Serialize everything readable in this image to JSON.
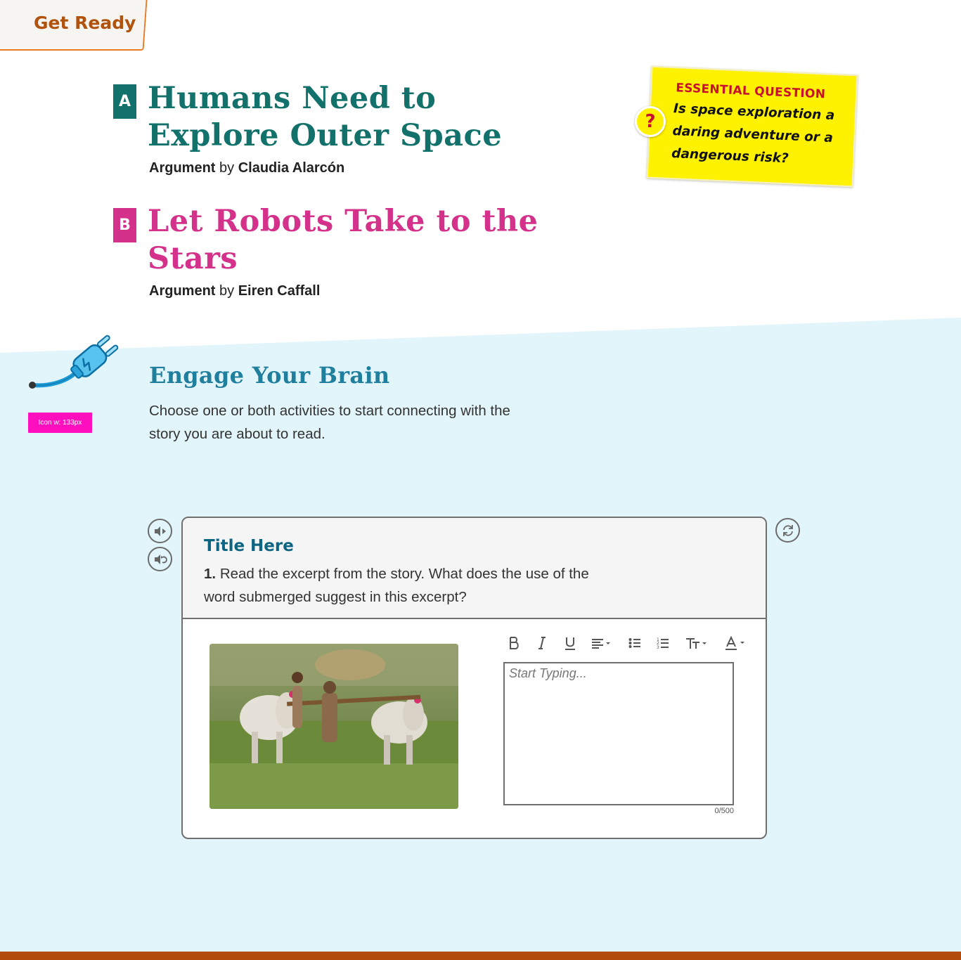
{
  "section_tab": {
    "label": "Get Ready"
  },
  "selections": [
    {
      "badge": "A",
      "title": "Humans Need to Explore Outer Space",
      "genre": "Argument",
      "by": "by",
      "author": "Claudia Alarcón",
      "color": "#12726b"
    },
    {
      "badge": "B",
      "title": "Let Robots Take to the Stars",
      "genre": "Argument",
      "by": "by",
      "author": "Eiren Caffall",
      "color": "#d4318a"
    }
  ],
  "essential_question": {
    "label": "ESSENTIAL QUESTION",
    "text": "Is space exploration a daring adventure or a dangerous risk?",
    "icon": "question-mark-icon",
    "icon_glyph": "?"
  },
  "engage": {
    "icon": "electric-plug-icon",
    "icon_note": "Icon w: 133px",
    "title": "Engage Your Brain",
    "description": "Choose one or both activities to start connecting with the story you are about to read."
  },
  "activity": {
    "title": "Title Here",
    "question_number": "1.",
    "question_text": "Read the excerpt from the story. What does the use of the word submerged suggest in this excerpt?",
    "image_icon": "photo-farmers-plowing-with-oxen",
    "editor_placeholder": "Start Typing...",
    "char_count": "0/500",
    "toolbar": [
      {
        "name": "bold-button",
        "icon": "bold-icon"
      },
      {
        "name": "italic-button",
        "icon": "italic-icon"
      },
      {
        "name": "underline-button",
        "icon": "underline-icon"
      },
      {
        "name": "align-dropdown",
        "icon": "align-left-icon"
      },
      {
        "name": "bullet-list-button",
        "icon": "bullet-list-icon"
      },
      {
        "name": "numbered-list-button",
        "icon": "numbered-list-icon"
      },
      {
        "name": "text-size-dropdown",
        "icon": "text-size-icon"
      },
      {
        "name": "text-color-dropdown",
        "icon": "text-color-icon"
      }
    ]
  },
  "controls": {
    "play_audio_icon": "speaker-play-icon",
    "replay_audio_icon": "speaker-replay-icon",
    "reset_icon": "refresh-icon"
  },
  "colors": {
    "accent_teal": "#12726b",
    "accent_pink": "#d4318a",
    "section_bg": "#e2f5fa",
    "footer": "#b24a0a",
    "eq_yellow": "#fff200",
    "tab_orange": "#e87a24"
  }
}
